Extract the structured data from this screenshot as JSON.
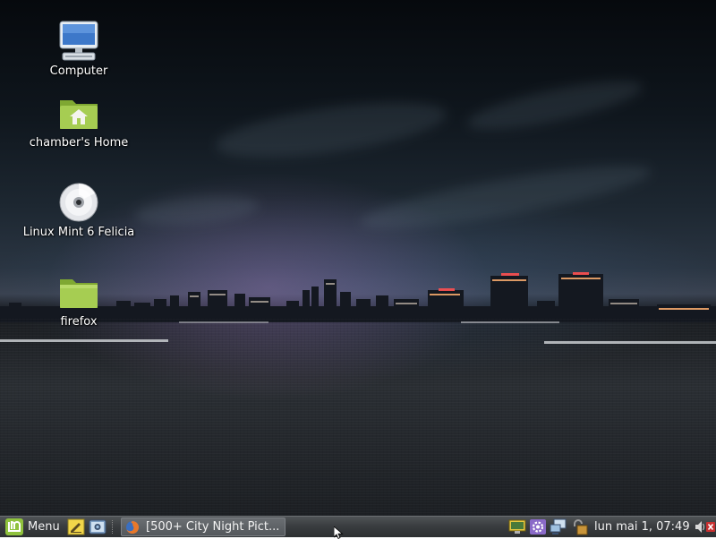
{
  "desktop": {
    "icons": [
      {
        "label": "Computer",
        "icon": "computer-icon"
      },
      {
        "label": "chamber's Home",
        "icon": "home-folder-icon"
      },
      {
        "label": "Linux Mint 6 Felicia",
        "icon": "cd-disc-icon"
      },
      {
        "label": "firefox",
        "icon": "folder-icon"
      }
    ]
  },
  "panel": {
    "menu_label": "Menu",
    "launchers": [
      "text-editor-icon",
      "screenshot-icon"
    ],
    "taskbar": [
      {
        "label": "[500+ City Night Pict...",
        "icon": "firefox-icon"
      }
    ],
    "tray": [
      "display-icon",
      "settings-gear-icon",
      "network-icon",
      "lock-icon"
    ],
    "clock": "lun mai  1, 07:49",
    "tray_end": [
      "volume-icon",
      "logout-icon"
    ]
  },
  "colors": {
    "mint_green": "#8fc23d",
    "panel_bg": "#3a3d40",
    "task_active": "#5e6266"
  }
}
